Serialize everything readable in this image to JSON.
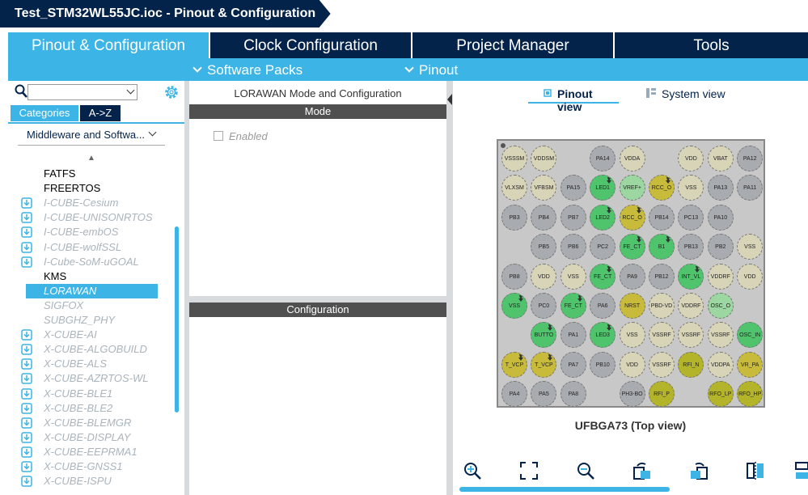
{
  "title": {
    "text": "Test_STM32WL55JC.ioc - Pinout & Configuration"
  },
  "tabs": [
    {
      "label": "Pinout & Configuration",
      "active": true
    },
    {
      "label": "Clock Configuration",
      "active": false
    },
    {
      "label": "Project Manager",
      "active": false
    },
    {
      "label": "Tools",
      "active": false
    }
  ],
  "subbar": {
    "software_packs": "Software Packs",
    "pinout": "Pinout"
  },
  "left": {
    "search_placeholder": "",
    "categories_tab": "Categories",
    "az_tab": "A->Z",
    "group_label": "Middleware and Softwa...",
    "items": [
      {
        "label": "FATFS",
        "style": "black",
        "icon": false
      },
      {
        "label": "FREERTOS",
        "style": "black",
        "icon": false
      },
      {
        "label": "I-CUBE-Cesium",
        "style": "gray",
        "icon": true
      },
      {
        "label": "I-CUBE-UNISONRTOS",
        "style": "gray",
        "icon": true
      },
      {
        "label": "I-CUBE-embOS",
        "style": "gray",
        "icon": true
      },
      {
        "label": "I-CUBE-wolfSSL",
        "style": "gray",
        "icon": true
      },
      {
        "label": "I-Cube-SoM-uGOAL",
        "style": "gray",
        "icon": true
      },
      {
        "label": "KMS",
        "style": "black",
        "icon": false
      },
      {
        "label": "LORAWAN",
        "style": "sel",
        "icon": false
      },
      {
        "label": "SIGFOX",
        "style": "gray",
        "icon": false
      },
      {
        "label": "SUBGHZ_PHY",
        "style": "gray",
        "icon": false
      },
      {
        "label": "X-CUBE-AI",
        "style": "gray",
        "icon": true
      },
      {
        "label": "X-CUBE-ALGOBUILD",
        "style": "gray",
        "icon": true
      },
      {
        "label": "X-CUBE-ALS",
        "style": "gray",
        "icon": true
      },
      {
        "label": "X-CUBE-AZRTOS-WL",
        "style": "gray",
        "icon": true
      },
      {
        "label": "X-CUBE-BLE1",
        "style": "gray",
        "icon": true
      },
      {
        "label": "X-CUBE-BLE2",
        "style": "gray",
        "icon": true
      },
      {
        "label": "X-CUBE-BLEMGR",
        "style": "gray",
        "icon": true
      },
      {
        "label": "X-CUBE-DISPLAY",
        "style": "gray",
        "icon": true
      },
      {
        "label": "X-CUBE-EEPRMA1",
        "style": "gray",
        "icon": true
      },
      {
        "label": "X-CUBE-GNSS1",
        "style": "gray",
        "icon": true
      },
      {
        "label": "X-CUBE-ISPU",
        "style": "gray",
        "icon": true
      }
    ]
  },
  "middle": {
    "title": "LORAWAN Mode and Configuration",
    "mode_header": "Mode",
    "enabled_label": "Enabled",
    "config_header": "Configuration"
  },
  "right": {
    "pinout_view": "Pinout view",
    "system_view": "System view",
    "chip_label": "UFBGA73 (Top view)",
    "pins": [
      [
        {
          "t": "VSSSM",
          "c": "beige"
        },
        {
          "t": "VDDSM",
          "c": "beige"
        },
        null,
        {
          "t": "PA14",
          "c": "gray"
        },
        {
          "t": "VDDA",
          "c": "beige"
        },
        null,
        {
          "t": "VDD",
          "c": "beige"
        },
        {
          "t": "VBAT",
          "c": "beige"
        },
        {
          "t": "PA12",
          "c": "gray"
        }
      ],
      [
        {
          "t": "VLXSM",
          "c": "beige"
        },
        {
          "t": "VFBSM",
          "c": "beige"
        },
        {
          "t": "PA15",
          "c": "gray"
        },
        {
          "t": "LED1",
          "c": "green",
          "p": true
        },
        {
          "t": "VREF+",
          "c": "lgreen"
        },
        {
          "t": "RCC_O",
          "c": "yellow",
          "p": true
        },
        {
          "t": "VSS",
          "c": "beige"
        },
        {
          "t": "PA13",
          "c": "gray"
        },
        {
          "t": "PA11",
          "c": "gray"
        }
      ],
      [
        {
          "t": "PB3",
          "c": "gray"
        },
        {
          "t": "PB4",
          "c": "gray"
        },
        {
          "t": "PB7",
          "c": "gray"
        },
        {
          "t": "LED2",
          "c": "green",
          "p": true
        },
        {
          "t": "RCC_O",
          "c": "yellow",
          "p": true
        },
        {
          "t": "PB14",
          "c": "gray"
        },
        {
          "t": "PC13",
          "c": "gray"
        },
        {
          "t": "PA10",
          "c": "gray"
        },
        null
      ],
      [
        null,
        {
          "t": "PB5",
          "c": "gray"
        },
        {
          "t": "PB6",
          "c": "gray"
        },
        {
          "t": "PC2",
          "c": "gray"
        },
        {
          "t": "FE_CT",
          "c": "green",
          "p": true
        },
        {
          "t": "B1",
          "c": "green",
          "p": true
        },
        {
          "t": "PB13",
          "c": "gray"
        },
        {
          "t": "PB2",
          "c": "gray"
        },
        {
          "t": "VSS",
          "c": "beige"
        }
      ],
      [
        {
          "t": "PB8",
          "c": "gray"
        },
        {
          "t": "VDD",
          "c": "beige"
        },
        {
          "t": "VSS",
          "c": "beige"
        },
        {
          "t": "FE_CT",
          "c": "green",
          "p": true
        },
        {
          "t": "PA9",
          "c": "gray"
        },
        {
          "t": "PB12",
          "c": "gray"
        },
        {
          "t": "INT_VL",
          "c": "green",
          "p": true
        },
        {
          "t": "VDDRF",
          "c": "beige"
        },
        {
          "t": "VDD",
          "c": "beige"
        }
      ],
      [
        {
          "t": "VSS",
          "c": "green",
          "p": true
        },
        {
          "t": "PC0",
          "c": "gray"
        },
        {
          "t": "FE_CT",
          "c": "green",
          "p": true
        },
        {
          "t": "PA6",
          "c": "gray"
        },
        {
          "t": "NRST",
          "c": "yellow"
        },
        {
          "t": "PBD-VD",
          "c": "beige"
        },
        {
          "t": "VDDRF",
          "c": "beige"
        },
        {
          "t": "OSC_O",
          "c": "lgreen"
        },
        null
      ],
      [
        null,
        {
          "t": "BUTTO",
          "c": "green",
          "p": true
        },
        {
          "t": "PA1",
          "c": "gray"
        },
        {
          "t": "LED3",
          "c": "green",
          "p": true
        },
        {
          "t": "VSS",
          "c": "beige"
        },
        {
          "t": "VSSRF",
          "c": "beige"
        },
        {
          "t": "VSSRF",
          "c": "beige"
        },
        {
          "t": "VSSRF",
          "c": "beige"
        },
        {
          "t": "OSC_IN",
          "c": "green"
        }
      ],
      [
        {
          "t": "T_VCP",
          "c": "yellow",
          "p": true
        },
        {
          "t": "T_VCP",
          "c": "yellow",
          "p": true
        },
        {
          "t": "PA7",
          "c": "gray"
        },
        {
          "t": "PB10",
          "c": "gray"
        },
        {
          "t": "VDD",
          "c": "beige"
        },
        {
          "t": "VSSRF",
          "c": "beige"
        },
        {
          "t": "RFI_N",
          "c": "olive"
        },
        {
          "t": "VDDPA",
          "c": "beige"
        },
        {
          "t": "VR_PA",
          "c": "yellow"
        }
      ],
      [
        {
          "t": "PA4",
          "c": "gray"
        },
        {
          "t": "PA5",
          "c": "gray"
        },
        {
          "t": "PA8",
          "c": "gray"
        },
        null,
        {
          "t": "PH3-BO",
          "c": "gray"
        },
        {
          "t": "RFI_P",
          "c": "olive"
        },
        null,
        {
          "t": "RFO_LP",
          "c": "olive"
        },
        {
          "t": "RFO_HP",
          "c": "olive"
        }
      ]
    ]
  }
}
